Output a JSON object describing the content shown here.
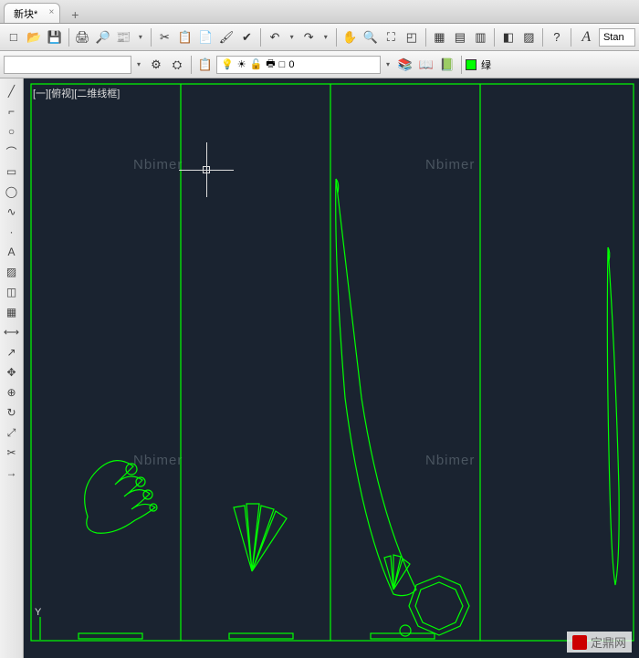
{
  "tabs": {
    "active": "新块*",
    "close": "×"
  },
  "toolbar": {
    "new": "□",
    "open": "📁",
    "save": "💾",
    "sep1": "|",
    "print": "🖨",
    "preview": "🔍",
    "plot": "📄",
    "sep2": "|",
    "cut": "✂",
    "copy": "📋",
    "paste": "📄",
    "paint": "🖌",
    "match": "✓",
    "sep3": "|",
    "undo": "↶",
    "redo": "↷",
    "sep4": "|",
    "pan": "✋",
    "zoom_in": "🔍",
    "zoom_ext": "🔲",
    "zoom_win": "⛶",
    "sep5": "|",
    "props": "▦",
    "design": "▤",
    "tool1": "▥",
    "sep6": "|",
    "block": "◧",
    "hatch": "▨",
    "sep7": "|",
    "help": "?",
    "text_style_label": "A",
    "style": "Stan"
  },
  "row2": {
    "settings": "⚙",
    "gear2": "⚙",
    "sep1": "|",
    "layer_mgr": "📋",
    "bulb": "💡",
    "sun": "☀",
    "lock": "🔒",
    "print": "🖶",
    "color": "□",
    "layer_name": "0",
    "layer_tools1": "📚",
    "layer_tools2": "📖",
    "layer_tools3": "📗",
    "color_name": "绿"
  },
  "side": {
    "line": "╱",
    "pline": "⌐",
    "circle": "○",
    "arc": "⌒",
    "rect": "▭",
    "ellipse": "◯",
    "spline": "∿",
    "point": "·",
    "text": "A",
    "hatch": "▨",
    "block": "◫",
    "table": "▦",
    "dim": "⟷",
    "leader": "↗",
    "move": "✥",
    "copy": "⊕",
    "rotate": "↻",
    "scale": "⤢",
    "trim": "✂",
    "extend": "→"
  },
  "viewport": {
    "label": "[一][俯视][二维线框]"
  },
  "watermarks": {
    "w1": "Nbimer",
    "w2": "Nbimer",
    "w3": "Nbimer",
    "w4": "Nbimer",
    "footer": "定鼎网"
  },
  "ucs": {
    "y": "Y"
  }
}
